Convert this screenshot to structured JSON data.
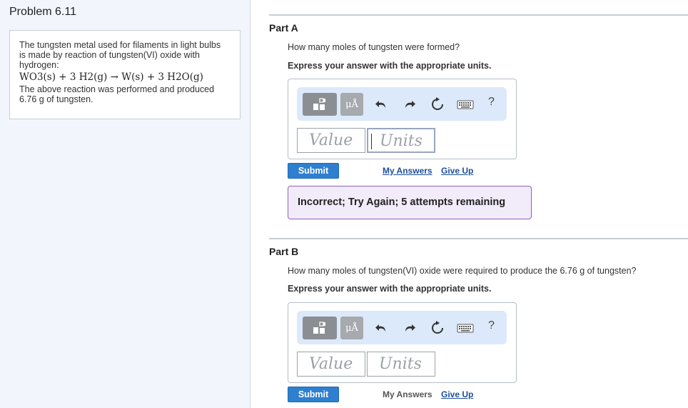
{
  "problem": {
    "title": "Problem 6.11",
    "intro_line1": "The tungsten metal used for filaments in light bulbs",
    "intro_line2": "is made by reaction of tungsten(VI) oxide with",
    "intro_line3": "hydrogen:",
    "equation": "WO3(s) + 3 H2(g) → W(s) + 3 H2O(g)",
    "outro_line1": "The above reaction was performed and produced",
    "outro_line2": "6.76 g of tungsten."
  },
  "toolbar": {
    "mu_label": "μÅ",
    "help_label": "?"
  },
  "part_a": {
    "title": "Part A",
    "question": "How many moles of tungsten were formed?",
    "instruction": "Express your answer with the appropriate units.",
    "value_placeholder": "Value",
    "units_placeholder": "Units",
    "submit": "Submit",
    "my_answers": "My Answers",
    "give_up": "Give Up",
    "feedback": "Incorrect; Try Again; 5 attempts remaining"
  },
  "part_b": {
    "title": "Part B",
    "question": "How many moles of tungsten(VI) oxide were required to produce the 6.76 g of tungsten?",
    "instruction": "Express your answer with the appropriate units.",
    "value_placeholder": "Value",
    "units_placeholder": "Units",
    "submit": "Submit",
    "my_answers": "My Answers",
    "give_up": "Give Up"
  },
  "colors": {
    "submit_bg": "#2f7fd0",
    "toolbar_bg": "#dce9fa",
    "feedback_bg": "#f1ebfa",
    "feedback_border": "#8a64b8",
    "left_panel_bg": "#f2f6fc"
  }
}
